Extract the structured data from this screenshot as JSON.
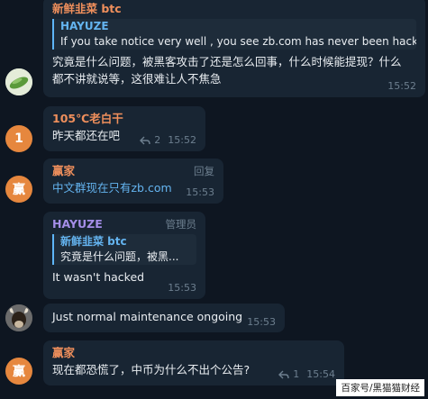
{
  "messages": [
    {
      "sender": "新鲜韭菜 btc",
      "sender_color": "#ef8f5c",
      "reply_to": {
        "name": "HAYUZE",
        "text": "If you take notice very well , you see zb.com has never been hack..."
      },
      "text": "究竟是什么问题，被黑客攻击了还是怎么回事，什么时候能提现？什么都不讲就说等，这很难让人不焦急",
      "time": "15:52"
    },
    {
      "sender": "105℃老白干",
      "sender_color": "#ef8f5c",
      "avatar_label": "1",
      "avatar_color": "#e6873e",
      "text": "昨天都还在吧",
      "replies_count": "2",
      "time": "15:52"
    },
    {
      "sender": "赢家",
      "sender_color": "#ef8f5c",
      "avatar_label": "赢",
      "avatar_color": "#e6873e",
      "role": "回复",
      "text": "中文群现在只有zb.com",
      "time": "15:53"
    },
    {
      "sender": "HAYUZE",
      "sender_color": "#a48ee8",
      "role": "管理员",
      "reply_to": {
        "name": "新鲜韭菜 btc",
        "text": "究竟是什么问题，被黑..."
      },
      "text": "It wasn't hacked",
      "time": "15:53"
    },
    {
      "text": "Just normal maintenance ongoing",
      "time": "15:53"
    },
    {
      "sender": "赢家",
      "sender_color": "#ef8f5c",
      "avatar_label": "赢",
      "avatar_color": "#e6873e",
      "text": "现在都恐慌了，中币为什么不出个公告?",
      "replies_count": "1",
      "time": "15:54"
    }
  ],
  "watermark": "百家号/黑猫猫财经"
}
